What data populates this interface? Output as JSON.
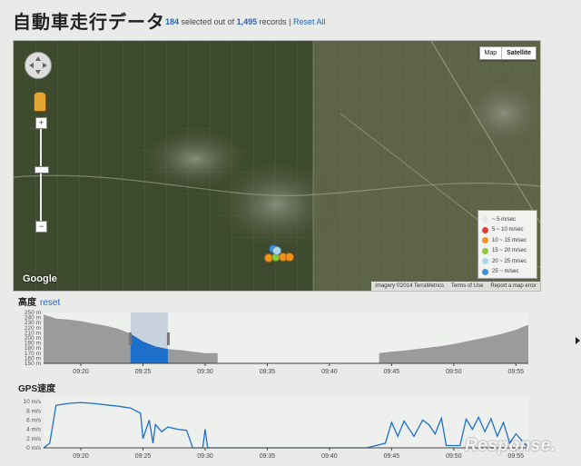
{
  "header": {
    "title": "自動車走行データ",
    "selected": "184",
    "mid_text": "selected out of",
    "total": "1,495",
    "records": "records |",
    "reset_all": "Reset All"
  },
  "map": {
    "type_map": "Map",
    "type_satellite": "Satellite",
    "zoom_in": "+",
    "zoom_out": "−",
    "google_logo": "Google",
    "attribution": "Imagery ©2014 TerraMetrics",
    "terms": "Terms of Use",
    "report": "Report a map error",
    "legend": [
      {
        "label": "~ 5 m/sec",
        "color": "#e8e8e8"
      },
      {
        "label": "5 ~ 10 m/sec",
        "color": "#e23b2e"
      },
      {
        "label": "10 ~ 15 m/sec",
        "color": "#f0931c"
      },
      {
        "label": "15 ~ 20 m/sec",
        "color": "#8cc83c"
      },
      {
        "label": "20 ~ 25 m/sec",
        "color": "#a8d8ea"
      },
      {
        "label": "25 ~ m/sec",
        "color": "#3a8fd8"
      }
    ]
  },
  "altitude": {
    "title": "高度",
    "reset": "reset",
    "y_ticks": [
      "250 m",
      "240 m",
      "230 m",
      "220 m",
      "210 m",
      "200 m",
      "190 m",
      "180 m",
      "170 m",
      "160 m",
      "150 m"
    ],
    "x_ticks": [
      "09:20",
      "09:25",
      "09:30",
      "09:35",
      "09:40",
      "09:45",
      "09:50",
      "09:55"
    ]
  },
  "speed": {
    "title": "GPS速度",
    "y_ticks": [
      "10 m/s",
      "8 m/s",
      "6 m/s",
      "4 m/s",
      "2 m/s",
      "0 m/s"
    ],
    "x_ticks": [
      "09:20",
      "09:25",
      "09:30",
      "09:35",
      "09:40",
      "09:45",
      "09:50",
      "09:55"
    ]
  },
  "chart_data": [
    {
      "type": "area",
      "title": "高度",
      "ylim": [
        150,
        250
      ],
      "x_range": [
        "09:17",
        "09:56"
      ],
      "brush": [
        "09:24",
        "09:27"
      ],
      "series": [
        {
          "x": [
            "09:17",
            "09:18",
            "09:19",
            "09:20",
            "09:21",
            "09:22",
            "09:23",
            "09:24",
            "09:25",
            "09:26",
            "09:27",
            "09:28",
            "09:29",
            "09:30",
            "09:31"
          ],
          "values": [
            246,
            238,
            236,
            233,
            228,
            224,
            218,
            208,
            193,
            183,
            178,
            176,
            173,
            170,
            170
          ]
        },
        {
          "x": [
            "09:44",
            "09:45",
            "09:46",
            "09:47",
            "09:48",
            "09:49",
            "09:50",
            "09:51",
            "09:52",
            "09:53",
            "09:54",
            "09:55",
            "09:56"
          ],
          "values": [
            170,
            173,
            175,
            178,
            181,
            184,
            188,
            193,
            198,
            203,
            209,
            216,
            226
          ]
        }
      ]
    },
    {
      "type": "line",
      "title": "GPS速度",
      "ylim": [
        0,
        11
      ],
      "x_range": [
        "09:17",
        "09:56"
      ],
      "points": [
        [
          "09:17",
          0
        ],
        [
          "09:17.5",
          1
        ],
        [
          "09:18",
          9.2
        ],
        [
          "09:19",
          9.6
        ],
        [
          "09:20",
          9.8
        ],
        [
          "09:21",
          9.6
        ],
        [
          "09:22",
          9.3
        ],
        [
          "09:23",
          9
        ],
        [
          "09:24",
          8.6
        ],
        [
          "09:24.8",
          7.5
        ],
        [
          "09:25",
          2
        ],
        [
          "09:25.5",
          6
        ],
        [
          "09:25.8",
          1
        ],
        [
          "09:26",
          5
        ],
        [
          "09:26.5",
          3.5
        ],
        [
          "09:27",
          4.5
        ],
        [
          "09:27.8",
          4
        ],
        [
          "09:28.5",
          3.8
        ],
        [
          "09:29",
          0
        ],
        [
          "09:29.8",
          0
        ],
        [
          "09:30",
          4
        ],
        [
          "09:30.2",
          0
        ],
        [
          "09:31",
          0
        ],
        [
          "09:43",
          0
        ],
        [
          "09:44.5",
          1
        ],
        [
          "09:45",
          5.5
        ],
        [
          "09:45.5",
          2.5
        ],
        [
          "09:46",
          5.8
        ],
        [
          "09:46.8",
          2.5
        ],
        [
          "09:47.5",
          6
        ],
        [
          "09:48",
          5
        ],
        [
          "09:48.5",
          3
        ],
        [
          "09:49",
          6.4
        ],
        [
          "09:49.4",
          0.5
        ],
        [
          "09:50.5",
          0.5
        ],
        [
          "09:51",
          6.2
        ],
        [
          "09:51.5",
          4
        ],
        [
          "09:52",
          6.6
        ],
        [
          "09:52.5",
          3.5
        ],
        [
          "09:53",
          6.3
        ],
        [
          "09:53.5",
          2.5
        ],
        [
          "09:54",
          5.5
        ],
        [
          "09:54.5",
          1
        ],
        [
          "09:55",
          3
        ],
        [
          "09:56",
          0
        ]
      ]
    }
  ]
}
